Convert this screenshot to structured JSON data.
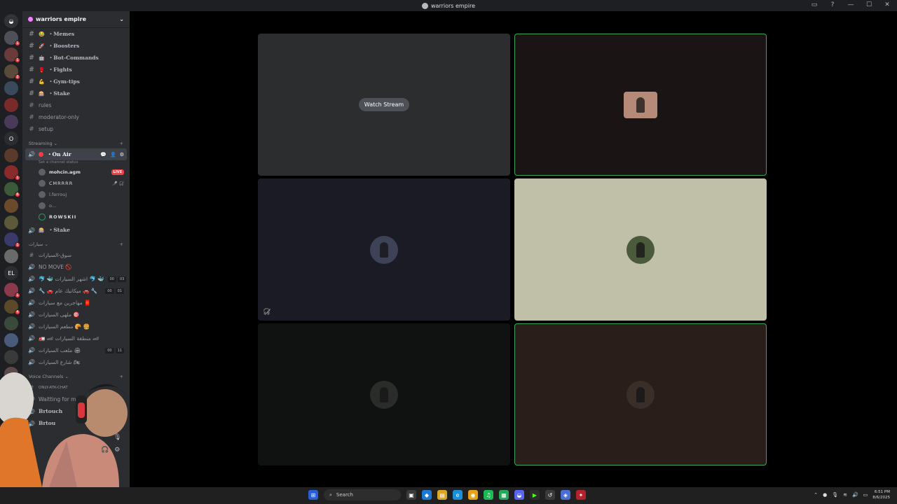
{
  "window": {
    "title": "warriors empire",
    "controls": [
      "inbox-icon",
      "help-icon",
      "minimize-icon",
      "maximize-icon",
      "close-icon"
    ]
  },
  "guilds": [
    {
      "label": "",
      "badge": "1"
    },
    {
      "label": "",
      "badge": "1"
    },
    {
      "label": "",
      "badge": "2"
    },
    {
      "label": "",
      "badge": ""
    },
    {
      "label": "",
      "badge": ""
    },
    {
      "label": "",
      "badge": ""
    },
    {
      "label": "O",
      "badge": ""
    },
    {
      "label": "",
      "badge": ""
    },
    {
      "label": "",
      "badge": "1"
    },
    {
      "label": "",
      "badge": "6"
    },
    {
      "label": "",
      "badge": ""
    },
    {
      "label": "",
      "badge": ""
    },
    {
      "label": "",
      "badge": "1"
    },
    {
      "label": "",
      "badge": ""
    },
    {
      "label": "EL",
      "badge": ""
    },
    {
      "label": "",
      "badge": "1"
    },
    {
      "label": "",
      "badge": "4"
    },
    {
      "label": "",
      "badge": ""
    },
    {
      "label": "",
      "badge": ""
    },
    {
      "label": "",
      "badge": ""
    },
    {
      "label": "",
      "badge": ""
    }
  ],
  "server": {
    "name": "warriors empire"
  },
  "text_channels": [
    {
      "emoji": "😂",
      "name": "・Memes",
      "style": "bold"
    },
    {
      "emoji": "🚀",
      "name": "・Boosters",
      "style": "bold"
    },
    {
      "emoji": "🤖",
      "name": "・Bot-Commands",
      "style": "bold"
    },
    {
      "emoji": "🥊",
      "name": "・Fights",
      "style": "bold"
    },
    {
      "emoji": "💪",
      "name": "・Gym-tips",
      "style": "bold"
    },
    {
      "emoji": "🎰",
      "name": "・Stake",
      "style": "bold"
    },
    {
      "emoji": "",
      "name": "rules",
      "style": ""
    },
    {
      "emoji": "",
      "name": "moderator-only",
      "style": ""
    },
    {
      "emoji": "",
      "name": "setup",
      "style": ""
    }
  ],
  "streaming": {
    "category": "Streaming",
    "active_channel": "・On Air",
    "status_placeholder": "Set a channel status",
    "users": [
      {
        "name": "mohcin.agm",
        "live": "LIVE"
      },
      {
        "name": "CMRRRR",
        "live": ""
      },
      {
        "name": "l.ferrouj",
        "live": ""
      },
      {
        "name": "o...",
        "live": ""
      },
      {
        "name": "ROWSKII",
        "live": ""
      }
    ],
    "stake_channel": "・Stake"
  },
  "arabic_category": {
    "name": "سيارات",
    "channels": [
      {
        "name": "سوق-السيارات",
        "counts": []
      },
      {
        "name": "NO MOVE 🚫",
        "counts": []
      },
      {
        "name": "🐬 🐳 اشهر السيارات 🐬 🐳",
        "counts": [
          "00",
          "03"
        ]
      },
      {
        "name": "🔧 🚗 ميكانيك عام 🚗 🔧",
        "counts": [
          "00",
          "01"
        ]
      },
      {
        "name": "مهاجرين مع سيارات 🧧",
        "counts": []
      },
      {
        "name": "ملهى السيارات 🎯",
        "counts": []
      },
      {
        "name": "مطعم السيارات 🥐 🍔",
        "counts": []
      },
      {
        "name": "🚛 🏎 منطقة السيارات 🏎",
        "counts": []
      },
      {
        "name": "ملعب السيارات 🏟",
        "counts": [
          "00",
          "11"
        ]
      },
      {
        "name": "شارع السيارات 🏍",
        "counts": []
      }
    ]
  },
  "voice_category": {
    "name": "Voice Channels",
    "channels": [
      {
        "name": "ONLY-ATK-CHAT"
      },
      {
        "name": "Waitting for mov"
      },
      {
        "name": "Brtouch"
      },
      {
        "name": "Brtou"
      }
    ]
  },
  "stage": {
    "tiles": [
      {
        "type": "stream",
        "button": "Watch Stream",
        "speaking": false,
        "bg": "#2b2d2f"
      },
      {
        "type": "user",
        "speaking": true,
        "bg": "#1a1414"
      },
      {
        "type": "user",
        "speaking": false,
        "bg": "#1a1b24",
        "muted": true
      },
      {
        "type": "user",
        "speaking": false,
        "bg": "#bfc0a7"
      },
      {
        "type": "user",
        "speaking": false,
        "bg": "#101211"
      },
      {
        "type": "user",
        "speaking": true,
        "bg": "#2a1e1a"
      }
    ]
  },
  "taskbar": {
    "search_placeholder": "Search",
    "time": "6:51 PM",
    "date": "8/6/2025"
  },
  "colors": {
    "speaking_border": "#3ba55c",
    "live_badge": "#f23f43",
    "sidebar_bg": "#2b2d31"
  }
}
